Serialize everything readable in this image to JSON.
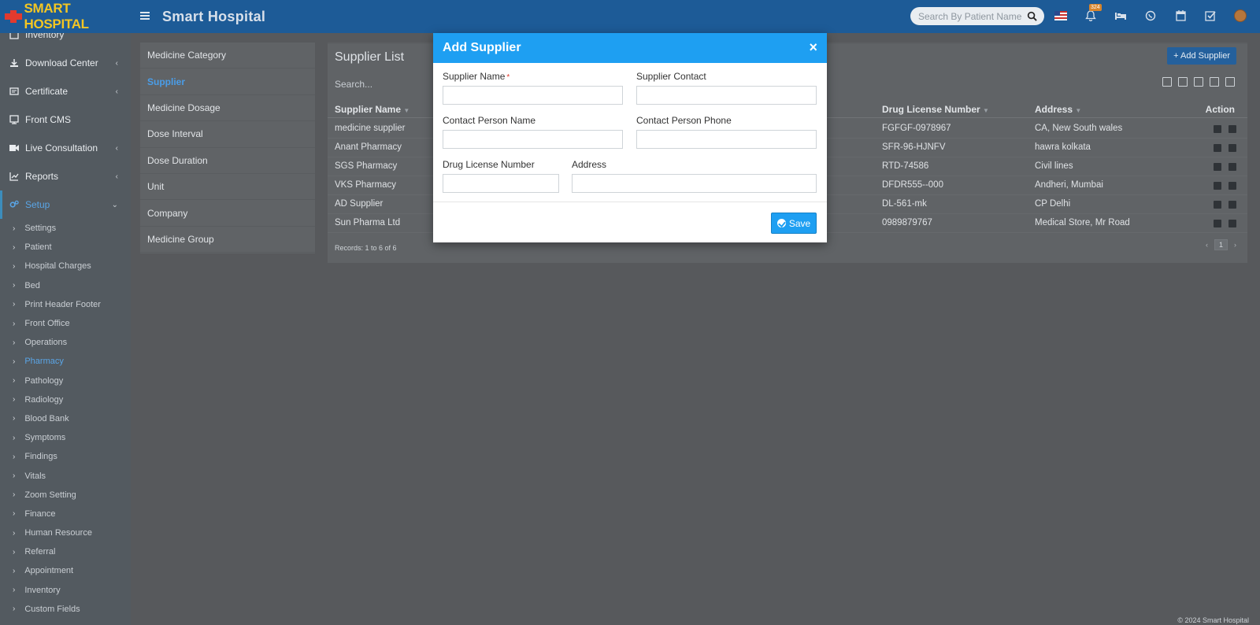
{
  "header": {
    "logo_text": "SMART HOSPITAL",
    "app_title": "Smart Hospital",
    "search_placeholder": "Search By Patient Name",
    "notification_count": "324"
  },
  "sidebar": {
    "items": [
      {
        "label": "Inventory",
        "icon": "inventory-icon",
        "chevron": false
      },
      {
        "label": "Download Center",
        "icon": "download-icon",
        "chevron": true
      },
      {
        "label": "Certificate",
        "icon": "certificate-icon",
        "chevron": true
      },
      {
        "label": "Front CMS",
        "icon": "cms-icon",
        "chevron": false
      },
      {
        "label": "Live Consultation",
        "icon": "video-icon",
        "chevron": true
      },
      {
        "label": "Reports",
        "icon": "chart-icon",
        "chevron": true
      },
      {
        "label": "Setup",
        "icon": "gears-icon",
        "chevron": true
      }
    ],
    "setup_items": [
      "Settings",
      "Patient",
      "Hospital Charges",
      "Bed",
      "Print Header Footer",
      "Front Office",
      "Operations",
      "Pharmacy",
      "Pathology",
      "Radiology",
      "Blood Bank",
      "Symptoms",
      "Findings",
      "Vitals",
      "Zoom Setting",
      "Finance",
      "Human Resource",
      "Referral",
      "Appointment",
      "Inventory",
      "Custom Fields"
    ],
    "active_setup_item": "Pharmacy"
  },
  "submenu": {
    "items": [
      "Medicine Category",
      "Supplier",
      "Medicine Dosage",
      "Dose Interval",
      "Dose Duration",
      "Unit",
      "Company",
      "Medicine Group"
    ],
    "active": "Supplier"
  },
  "panel": {
    "title": "Supplier List",
    "add_button": "+ Add Supplier",
    "search_label": "Search...",
    "columns": {
      "name": "Supplier Name",
      "license": "Drug License Number",
      "address": "Address",
      "action": "Action"
    },
    "rows": [
      {
        "name": "medicine supplier",
        "license": "FGFGF-0978967",
        "address": "CA, New South wales"
      },
      {
        "name": "Anant Pharmacy",
        "license": "SFR-96-HJNFV",
        "address": "hawra kolkata"
      },
      {
        "name": "SGS Pharmacy",
        "license": "RTD-74586",
        "address": "Civil lines"
      },
      {
        "name": "VKS Pharmacy",
        "license": "DFDR555--000",
        "address": "Andheri, Mumbai"
      },
      {
        "name": "AD Supplier",
        "license": "DL-561-mk",
        "address": "CP Delhi"
      },
      {
        "name": "Sun Pharma Ltd",
        "license": "0989879767",
        "address": "Medical Store, Mr Road"
      }
    ],
    "records": "Records: 1 to 6 of 6",
    "page": "1"
  },
  "modal": {
    "title": "Add Supplier",
    "close": "×",
    "fields": {
      "supplier_name": {
        "label": "Supplier Name",
        "required": "*",
        "value": ""
      },
      "supplier_contact": {
        "label": "Supplier Contact",
        "value": ""
      },
      "contact_person_name": {
        "label": "Contact Person Name",
        "value": ""
      },
      "contact_person_phone": {
        "label": "Contact Person Phone",
        "value": ""
      },
      "drug_license_number": {
        "label": "Drug License Number",
        "value": ""
      },
      "address": {
        "label": "Address",
        "value": ""
      }
    },
    "save_label": "Save"
  },
  "footer": {
    "text": "© 2024 Smart Hospital"
  },
  "colors": {
    "header": "#1d5b97",
    "modal_header": "#1e9ff2",
    "logo": "#f3c623",
    "active_link": "#5aa5e6"
  }
}
